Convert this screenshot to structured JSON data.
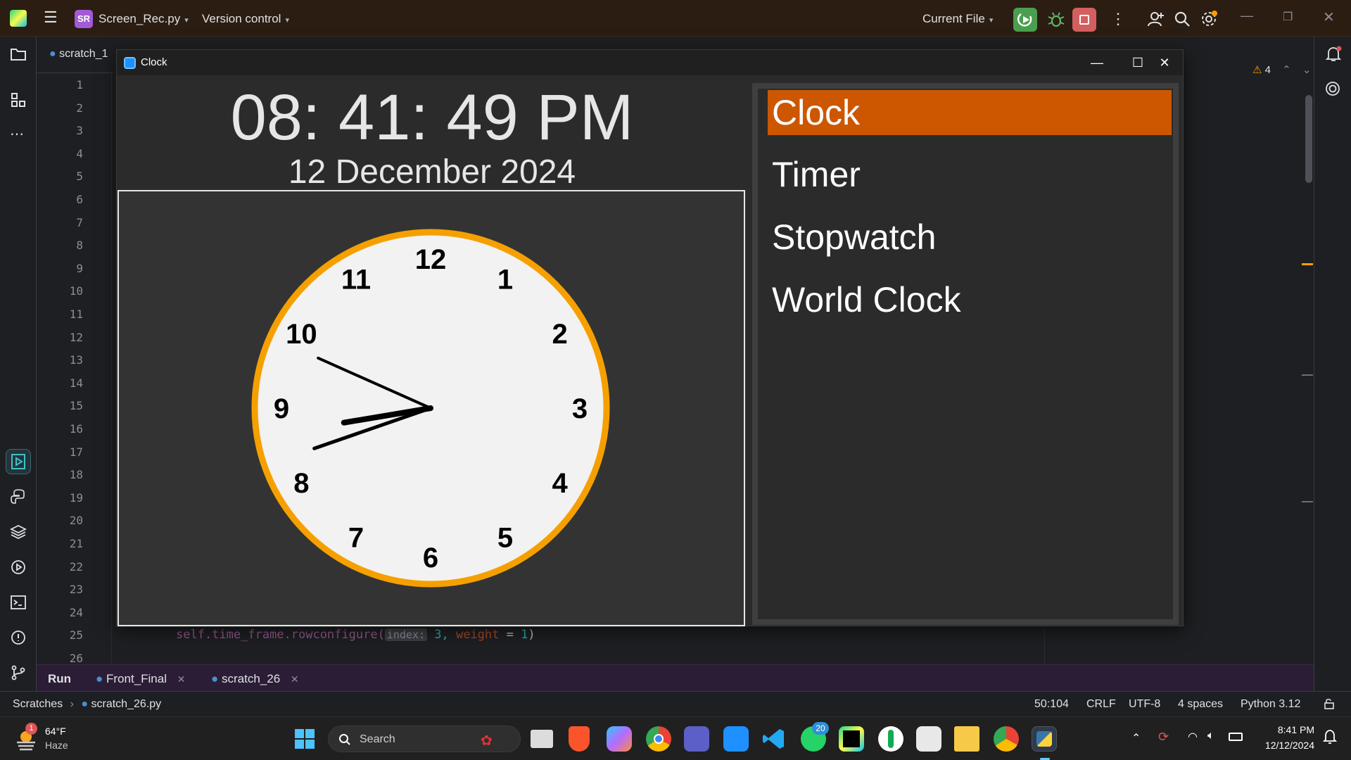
{
  "ide": {
    "project_badge": "SR",
    "file_name": "Screen_Rec.py",
    "vcs_label": "Version control",
    "run_config": "Current File",
    "editor_tab": "scratch_1",
    "warnings_count": "4",
    "line_numbers": [
      "1",
      "2",
      "3",
      "4",
      "5",
      "6",
      "7",
      "8",
      "9",
      "10",
      "11",
      "12",
      "13",
      "14",
      "15",
      "16",
      "17",
      "18",
      "19",
      "20",
      "21",
      "22",
      "23",
      "24",
      "25",
      "26"
    ],
    "code_line_25": {
      "prefix": "self.time_frame.rowconfigure(",
      "hint": "index:",
      "arg": " 3, ",
      "kw": "weight",
      "eq": " = ",
      "val": "1",
      "close": ")"
    }
  },
  "run_panel": {
    "label": "Run",
    "tabs": [
      {
        "label": "Front_Final"
      },
      {
        "label": "scratch_26"
      }
    ]
  },
  "status_bar": {
    "breadcrumb_root": "Scratches",
    "breadcrumb_file": "scratch_26.py",
    "position": "50:104",
    "line_sep": "CRLF",
    "encoding": "UTF-8",
    "indent": "4 spaces",
    "interpreter": "Python 3.12"
  },
  "clock_app": {
    "window_title": "Clock",
    "time": "08: 41: 49 PM",
    "date": "12 December 2024",
    "analog": {
      "hour": 8,
      "minute": 41,
      "second": 49,
      "numerals": [
        "12",
        "1",
        "2",
        "3",
        "4",
        "5",
        "6",
        "7",
        "8",
        "9",
        "10",
        "11"
      ],
      "rim_color": "#f5a000",
      "face_color": "#f2f2f2"
    },
    "nav_items": [
      {
        "label": "Clock",
        "active": true
      },
      {
        "label": "Timer",
        "active": false
      },
      {
        "label": "Stopwatch",
        "active": false
      },
      {
        "label": "World Clock",
        "active": false
      }
    ],
    "accent_color": "#cc5700"
  },
  "taskbar": {
    "weather_temp": "64°F",
    "weather_desc": "Haze",
    "weather_badge": "1",
    "search_placeholder": "Search",
    "whatsapp_badge": "20",
    "clock_time": "8:41 PM",
    "clock_date": "12/12/2024"
  }
}
